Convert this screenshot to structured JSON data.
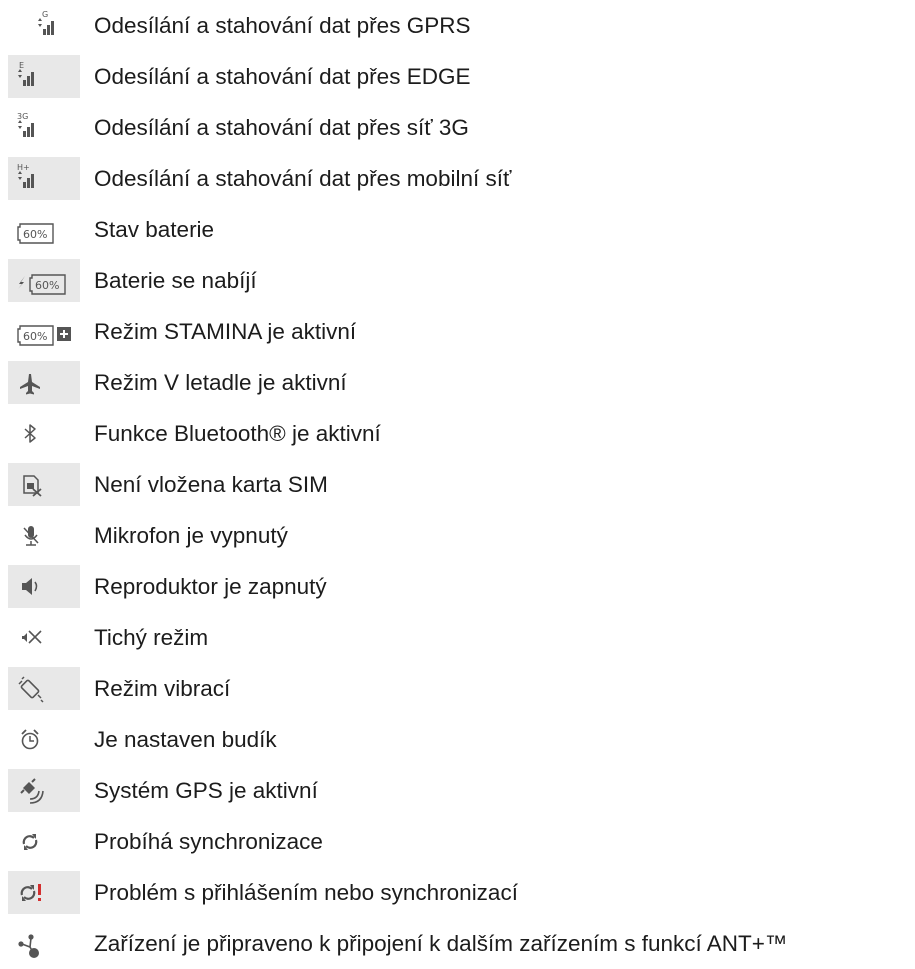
{
  "items": [
    {
      "icon": "signal-gprs-icon",
      "label": "Odesílání a stahování dat přes GPRS",
      "icon_text": "G"
    },
    {
      "icon": "signal-edge-icon",
      "label": "Odesílání a stahování dat přes EDGE",
      "icon_text": "E"
    },
    {
      "icon": "signal-3g-icon",
      "label": "Odesílání a stahování dat přes síť 3G",
      "icon_text": "3G"
    },
    {
      "icon": "signal-hplus-icon",
      "label": "Odesílání a stahování dat přes mobilní síť",
      "icon_text": "H+"
    },
    {
      "icon": "battery-status-icon",
      "label": "Stav baterie",
      "icon_text": "60%"
    },
    {
      "icon": "battery-charging-icon",
      "label": "Baterie se nabíjí",
      "icon_text": "60%"
    },
    {
      "icon": "battery-stamina-icon",
      "label": "Režim STAMINA je aktivní",
      "icon_text": "60%"
    },
    {
      "icon": "airplane-mode-icon",
      "label": "Režim V letadle je aktivní"
    },
    {
      "icon": "bluetooth-icon",
      "label": "Funkce Bluetooth® je aktivní"
    },
    {
      "icon": "no-sim-card-icon",
      "label": "Není vložena karta SIM"
    },
    {
      "icon": "microphone-muted-icon",
      "label": "Mikrofon je vypnutý"
    },
    {
      "icon": "speaker-on-icon",
      "label": "Reproduktor je zapnutý"
    },
    {
      "icon": "silent-mode-icon",
      "label": "Tichý režim"
    },
    {
      "icon": "vibrate-mode-icon",
      "label": "Režim vibrací"
    },
    {
      "icon": "alarm-clock-icon",
      "label": "Je nastaven budík"
    },
    {
      "icon": "gps-active-icon",
      "label": "Systém GPS je aktivní"
    },
    {
      "icon": "sync-icon",
      "label": "Probíhá synchronizace"
    },
    {
      "icon": "sync-problem-icon",
      "label": "Problém s přihlášením nebo synchronizací"
    },
    {
      "icon": "ant-plus-icon",
      "label": "Zařízení je připraveno k připojení k dalším zařízením s funkcí ANT+™"
    }
  ],
  "colors": {
    "icon_bg": "#e8e8e8",
    "icon": "#555555",
    "alert": "#d32f2f"
  }
}
